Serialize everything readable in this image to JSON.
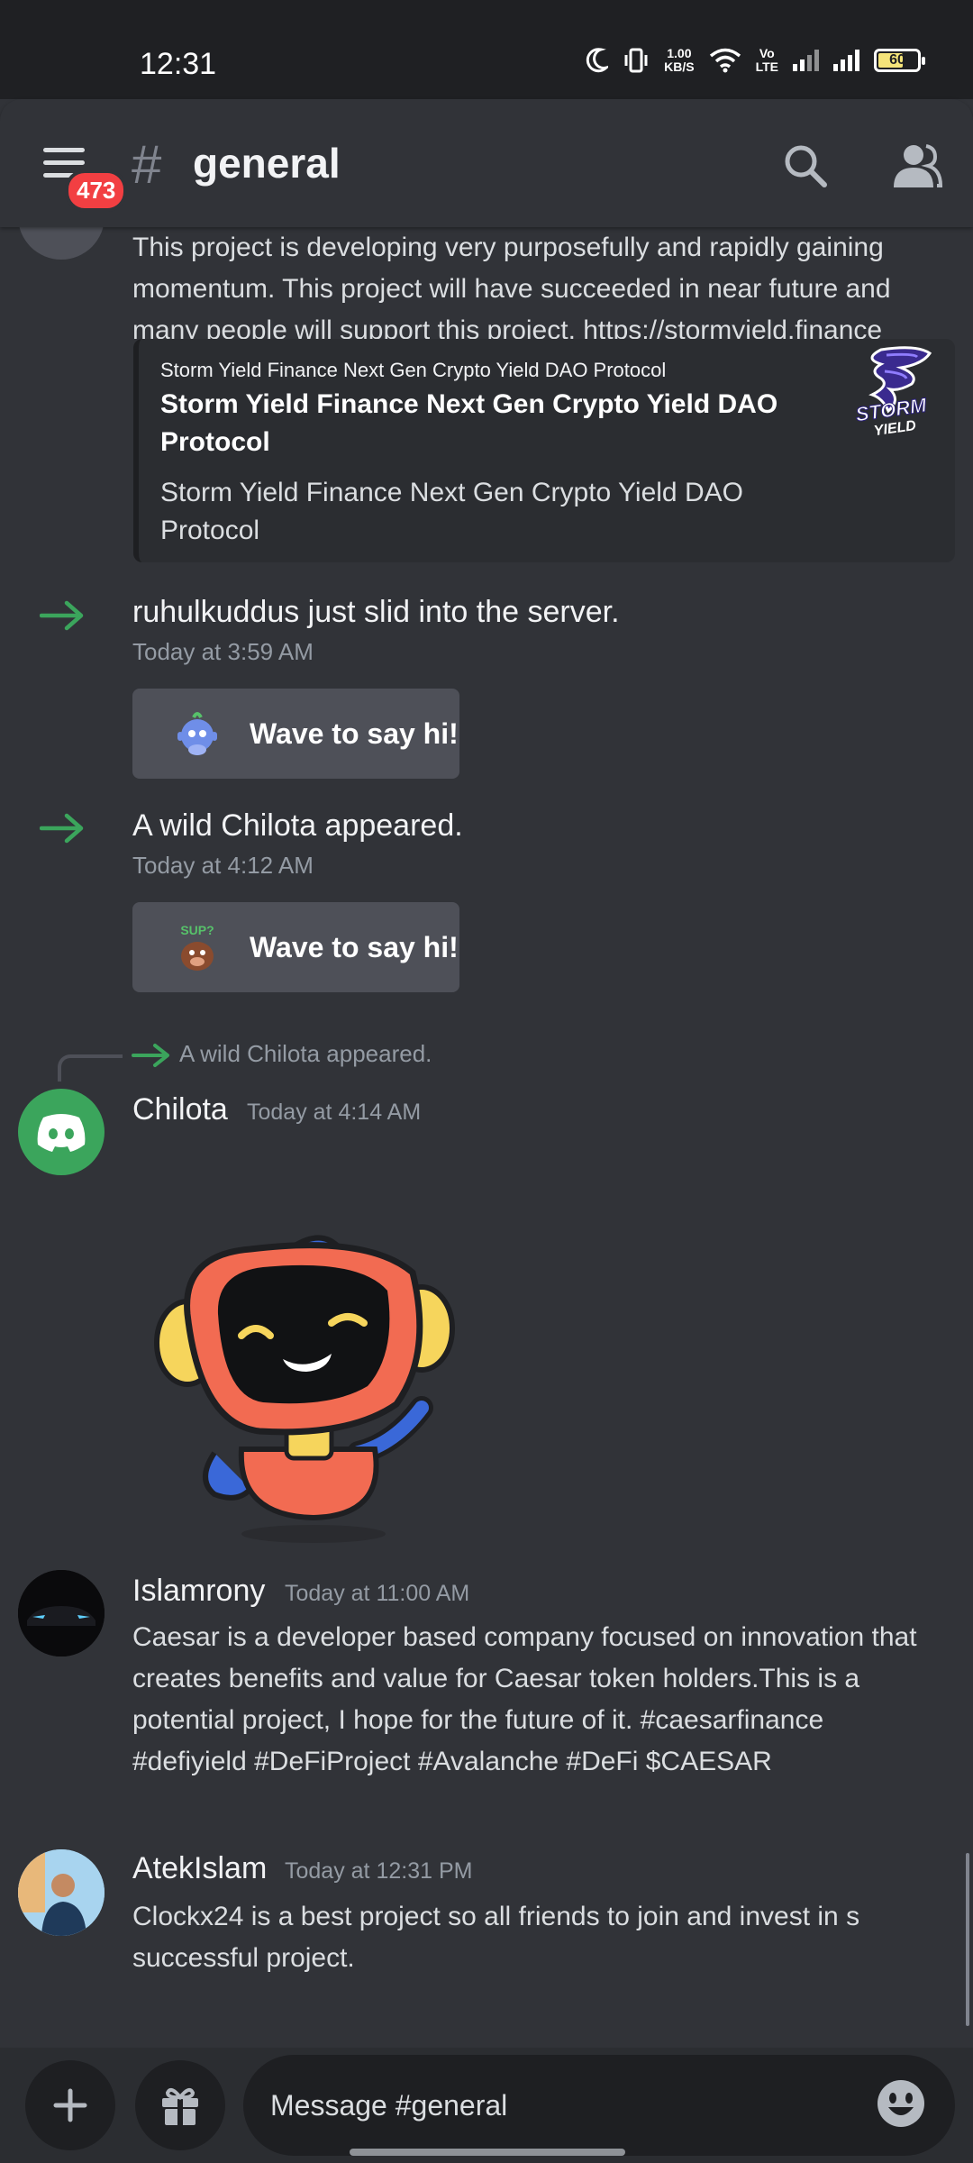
{
  "status_bar": {
    "time": "12:31",
    "net_speed_value": "1.00",
    "net_speed_unit": "KB/S",
    "volte_top": "Vo",
    "volte_bottom": "LTE",
    "battery": "60"
  },
  "header": {
    "hash_symbol": "#",
    "channel_name": "general",
    "unread_badge": "473"
  },
  "messages": {
    "m1_text": "This project is developing very purposefully and rapidly gaining momentum. This project will have succeeded in near future and many people will support this project. https://stormyield.finance",
    "embed": {
      "provider": "Storm Yield Finance Next Gen Crypto Yield DAO Protocol",
      "title": "Storm Yield Finance Next Gen Crypto Yield DAO Protocol",
      "description": "Storm Yield Finance Next Gen Crypto Yield DAO Protocol",
      "thumb_line1": "STORM",
      "thumb_line2": "YIELD"
    },
    "join1": {
      "text": "ruhulkuddus just slid into the server.",
      "time": "Today at 3:59 AM",
      "wave_label": "Wave to say hi!"
    },
    "join2": {
      "text": "A wild Chilota appeared.",
      "time": "Today at 4:12 AM",
      "wave_label": "Wave to say hi!",
      "sticker_text": "SUP?"
    },
    "chilota": {
      "reply_ref": "A wild Chilota appeared.",
      "username": "Chilota",
      "time": "Today at 4:14 AM"
    },
    "islamrony": {
      "username": "Islamrony",
      "time": "Today at 11:00 AM",
      "text": "Caesar is a developer based company focused on innovation that creates benefits and value for Caesar token holders.This is a potential project, I hope for the future of it. #caesarfinance #defiyield #DeFiProject #Avalanche #DeFi $CAESAR"
    },
    "atekislam": {
      "username": "AtekIslam",
      "time": "Today at 12:31 PM",
      "text": "Clockx24 is a  best project so all friends to join and invest in s successful project."
    }
  },
  "composer": {
    "placeholder": "Message #general"
  },
  "colors": {
    "background": "#313338",
    "join_arrow": "#3ba55c",
    "badge": "#f23f42",
    "discord_green": "#3ba55c"
  }
}
